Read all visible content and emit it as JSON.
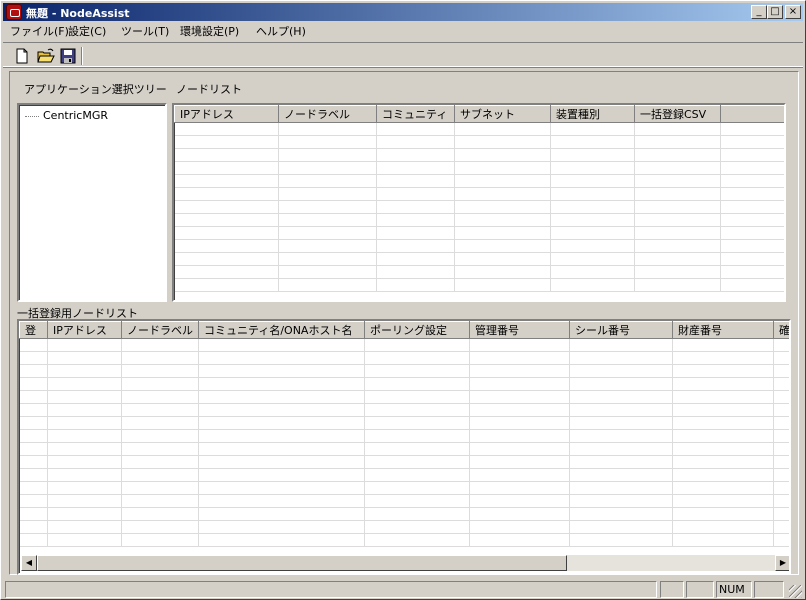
{
  "window": {
    "title": "無題 - NodeAssist",
    "minimize_glyph": "_",
    "maximize_glyph": "□",
    "close_glyph": "×"
  },
  "menu": {
    "file": "ファイル(F)",
    "settings": "設定(C)",
    "tools": "ツール(T)",
    "environment": "環境設定(P)",
    "help": "ヘルプ(H)"
  },
  "toolbar": {
    "icons": [
      "new-document-icon",
      "open-folder-icon",
      "save-disk-icon"
    ]
  },
  "tree": {
    "label": "アプリケーション選択ツリー",
    "items": [
      {
        "label": "CentricMGR"
      }
    ]
  },
  "node_list": {
    "label": "ノードリスト",
    "columns": [
      "IPアドレス",
      "ノードラベル",
      "コミュニティ",
      "サブネット",
      "装置種別",
      "一括登録CSV"
    ]
  },
  "bulk_list": {
    "label": "一括登録用ノードリスト",
    "columns": [
      "登",
      "IPアドレス",
      "ノードラベル",
      "コミュニティ名/ONAホスト名",
      "ポーリング設定",
      "管理番号",
      "シール番号",
      "財産番号",
      "確"
    ]
  },
  "scrollbar": {
    "left_arrow": "◀",
    "right_arrow": "▶"
  },
  "status": {
    "panes": [
      "",
      "",
      "NUM",
      ""
    ]
  }
}
